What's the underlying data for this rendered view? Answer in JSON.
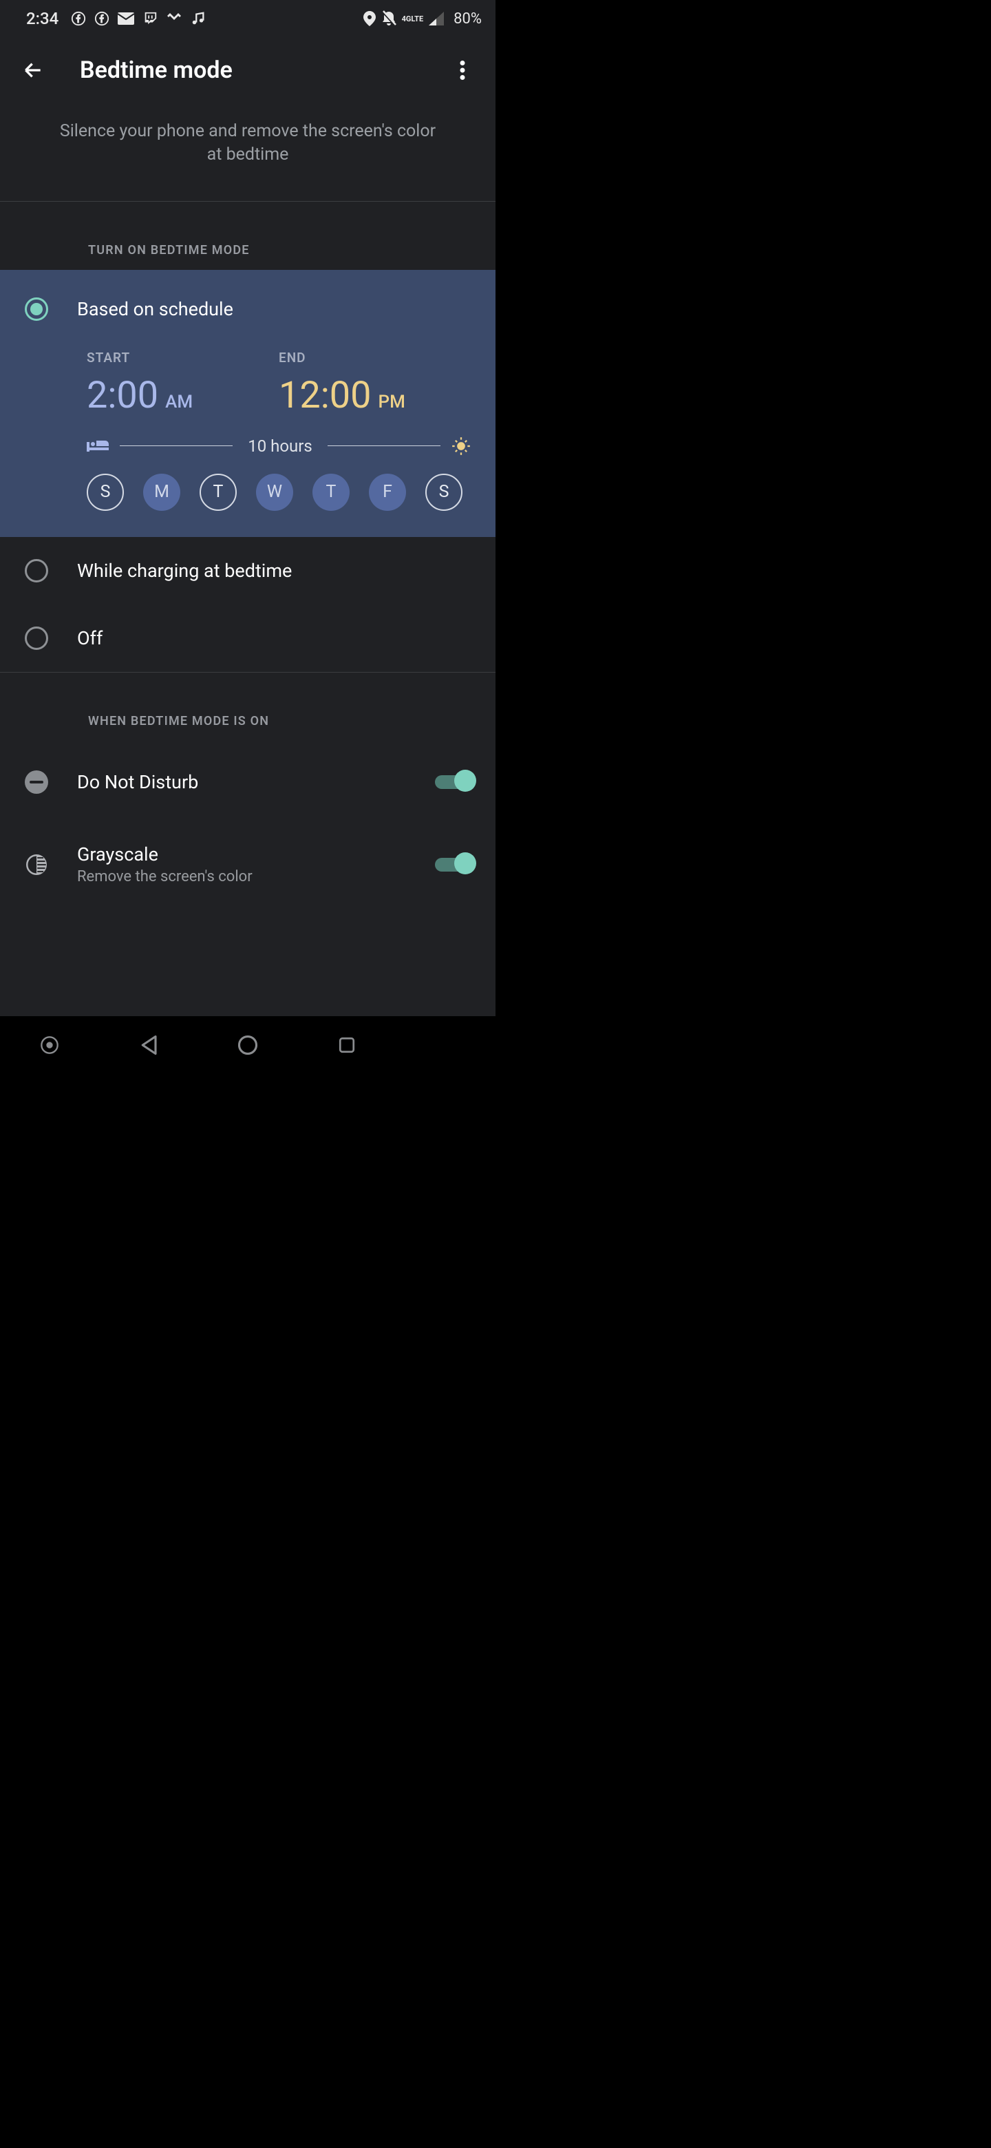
{
  "status": {
    "time": "2:34",
    "battery": "80%",
    "network": "4G LTE"
  },
  "header": {
    "title": "Bedtime mode"
  },
  "subtitle": "Silence your phone and remove the screen's color at bedtime",
  "sections": {
    "turn_on": "TURN ON BEDTIME MODE",
    "when_on": "WHEN BEDTIME MODE IS ON"
  },
  "options": {
    "schedule": "Based on schedule",
    "charging": "While charging at bedtime",
    "off": "Off",
    "selected": "schedule"
  },
  "schedule": {
    "start_label": "START",
    "start_time": "2:00",
    "start_ampm": "AM",
    "end_label": "END",
    "end_time": "12:00",
    "end_ampm": "PM",
    "duration": "10 hours",
    "days": [
      {
        "letter": "S",
        "on": false
      },
      {
        "letter": "M",
        "on": true
      },
      {
        "letter": "T",
        "on": false
      },
      {
        "letter": "W",
        "on": true
      },
      {
        "letter": "T",
        "on": true
      },
      {
        "letter": "F",
        "on": true
      },
      {
        "letter": "S",
        "on": false
      }
    ]
  },
  "settings": {
    "dnd": {
      "title": "Do Not Disturb",
      "on": true
    },
    "grayscale": {
      "title": "Grayscale",
      "sub": "Remove the screen's color",
      "on": true
    }
  }
}
